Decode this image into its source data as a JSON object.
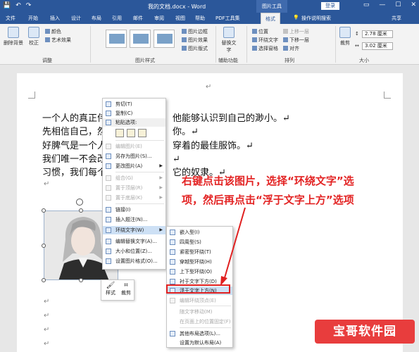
{
  "titlebar": {
    "doc_title": "我的文档.docx - Word",
    "context_title": "图片工具",
    "login": "登录",
    "qat": [
      "💾",
      "↶",
      "↷"
    ]
  },
  "tabs": [
    "文件",
    "开始",
    "插入",
    "设计",
    "布局",
    "引用",
    "邮件",
    "审阅",
    "视图",
    "帮助",
    "PDF工具集",
    "格式",
    "💡",
    "操作说明搜索",
    "共享"
  ],
  "ribbon": {
    "remove_bg": "删除背景",
    "correct": "校正",
    "color": "颜色",
    "artistic": "艺术效果",
    "adjust_group": "调整",
    "styles_group": "图片样式",
    "border": "图片边框",
    "effect": "图片效果",
    "layout": "图片版式",
    "alt_text": "替换文字",
    "aux_group": "辅助功能",
    "position": "位置",
    "wrap": "环绕文字",
    "forward": "上移一层",
    "backward": "下移一层",
    "selection_pane": "选择窗格",
    "align": "对齐",
    "arrange_group": "排列",
    "crop": "裁剪",
    "height": "2.78 厘米",
    "width": "3.02 厘米",
    "size_group": "大小"
  },
  "document": {
    "lines": [
      "一个人的真正伟大之处，就在于他能够认识到自己的渺小。↵",
      "先相信自己，然后别人才会相信你。↵",
      "好脾气是一个人在社交中所能穿着的最佳服饰。↵",
      "我们唯一不会改正的缺点是软弱。↵",
      "习惯，我们每个人或多或少都是它的奴隶。↵"
    ],
    "line_prefixes": [
      "一个人的真正伟",
      "先相信自己，然",
      "好脾气是一个人",
      "我们唯一不会改",
      "习惯，我们每个"
    ],
    "line_suffixes": [
      "他能够认识到自己的渺小。↵",
      "你。↵",
      "穿着的最佳服饰。↵",
      "↵",
      "它的奴隶。↵"
    ],
    "para_mark": "↵"
  },
  "context_menu": {
    "items": [
      "剪切(T)",
      "复制(C)",
      "粘贴选项:",
      "编辑图片(E)",
      "另存为图片(S)...",
      "更改图片(A)",
      "组合(G)",
      "置于顶层(R)",
      "置于底层(K)",
      "链接(I)",
      "插入题注(N)...",
      "环绕文字(W)",
      "编辑替换文字(A)...",
      "大小和位置(Z)...",
      "设置图片格式(O)..."
    ]
  },
  "wrap_submenu": {
    "items": [
      "嵌入型(I)",
      "四周型(S)",
      "紧密型环绕(T)",
      "穿越型环绕(H)",
      "上下型环绕(O)",
      "衬于文字下方(D)",
      "浮于文字上方(N)",
      "编辑环绕顶点(E)",
      "随文字移动(M)",
      "在页面上的位置固定(F)",
      "其他布局选项(L)...",
      "设置为默认布局(A)"
    ]
  },
  "minibar": {
    "style": "样式",
    "crop": "裁剪"
  },
  "annotation": {
    "line1": "右键点击该图片，选择“环绕文字”选",
    "line2": "项，然后再点击“浮于文字上方”选项"
  },
  "watermark": "宝哥软件园",
  "colors": {
    "accent": "#2b579a",
    "annotation": "#e32424"
  }
}
